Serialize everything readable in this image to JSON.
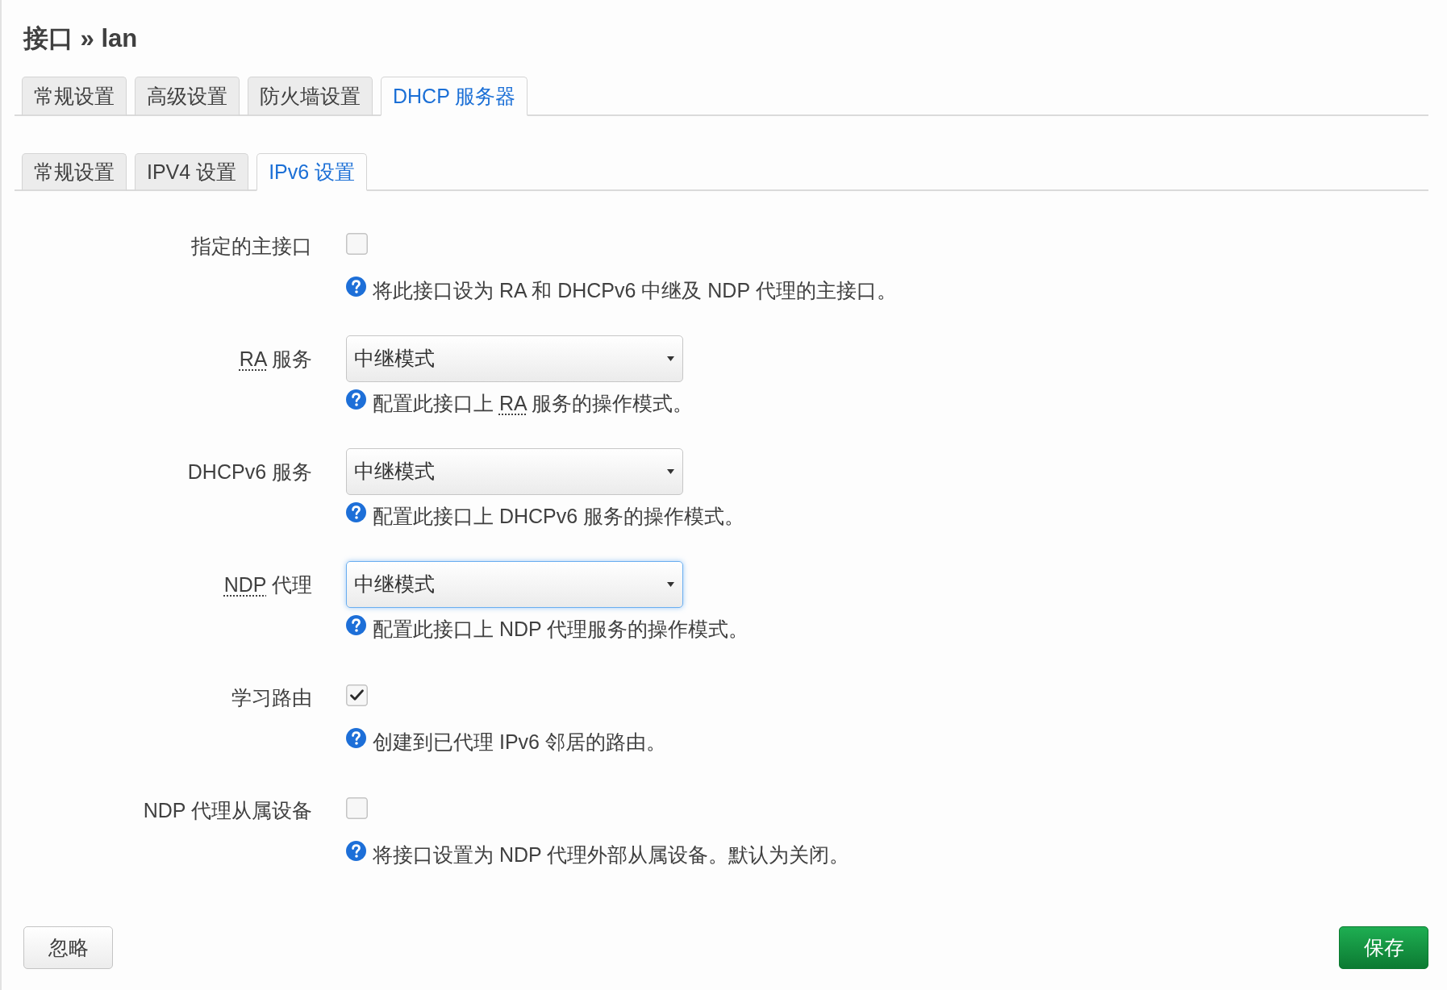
{
  "title": "接口 » lan",
  "tabs": [
    {
      "label": "常规设置",
      "selected": false
    },
    {
      "label": "高级设置",
      "selected": false
    },
    {
      "label": "防火墙设置",
      "selected": false
    },
    {
      "label": "DHCP 服务器",
      "selected": true
    }
  ],
  "subtabs": [
    {
      "label": "常规设置",
      "selected": false
    },
    {
      "label": "IPV4 设置",
      "selected": false
    },
    {
      "label": "IPv6 设置",
      "selected": true
    }
  ],
  "fields": [
    {
      "kind": "checkbox",
      "label": [
        {
          "text": "指定的主接口",
          "abbr": false
        }
      ],
      "checked": false,
      "help": [
        {
          "text": "将此接口设为 RA 和 DHCPv6 中继及 NDP 代理的主接口。",
          "abbr": false
        }
      ]
    },
    {
      "kind": "select",
      "label": [
        {
          "text": "RA",
          "abbr": true
        },
        {
          "text": " 服务",
          "abbr": false
        }
      ],
      "value": "中继模式",
      "focused": false,
      "help": [
        {
          "text": "配置此接口上 ",
          "abbr": false
        },
        {
          "text": "RA",
          "abbr": true
        },
        {
          "text": " 服务的操作模式。",
          "abbr": false
        }
      ]
    },
    {
      "kind": "select",
      "label": [
        {
          "text": "DHCPv6 服务",
          "abbr": false
        }
      ],
      "value": "中继模式",
      "focused": false,
      "help": [
        {
          "text": "配置此接口上 DHCPv6 服务的操作模式。",
          "abbr": false
        }
      ]
    },
    {
      "kind": "select",
      "label": [
        {
          "text": "NDP",
          "abbr": true
        },
        {
          "text": " 代理",
          "abbr": false
        }
      ],
      "value": "中继模式",
      "focused": true,
      "help": [
        {
          "text": "配置此接口上 NDP 代理服务的操作模式。",
          "abbr": false
        }
      ]
    },
    {
      "kind": "checkbox",
      "label": [
        {
          "text": "学习路由",
          "abbr": false
        }
      ],
      "checked": true,
      "help": [
        {
          "text": "创建到已代理 IPv6 邻居的路由。",
          "abbr": false
        }
      ]
    },
    {
      "kind": "checkbox",
      "label": [
        {
          "text": "NDP 代理从属设备",
          "abbr": false
        }
      ],
      "checked": false,
      "help": [
        {
          "text": "将接口设置为 NDP 代理外部从属设备。默认为关闭。",
          "abbr": false
        }
      ]
    }
  ],
  "buttons": [
    {
      "label": "忽略",
      "kind": "dismiss"
    },
    {
      "label": "保存",
      "kind": "save"
    }
  ]
}
